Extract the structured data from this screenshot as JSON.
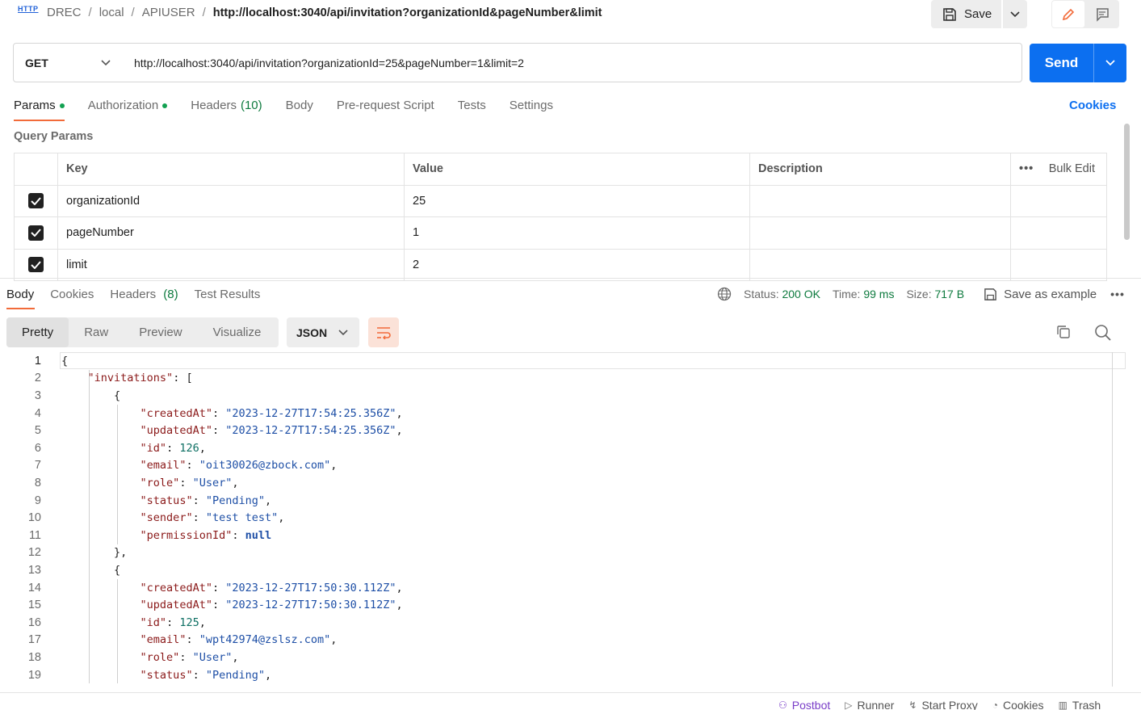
{
  "breadcrumb": {
    "method_icon": "HTTP",
    "items": [
      "DREC",
      "local",
      "APIUSER"
    ],
    "current": "http://localhost:3040/api/invitation?organizationId&pageNumber&limit"
  },
  "toolbar": {
    "save_label": "Save"
  },
  "request": {
    "method": "GET",
    "url": "http://localhost:3040/api/invitation?organizationId=25&pageNumber=1&limit=2",
    "send_label": "Send"
  },
  "request_tabs": [
    {
      "label": "Params",
      "dot": true
    },
    {
      "label": "Authorization",
      "dot": true
    },
    {
      "label": "Headers",
      "count": "(10)"
    },
    {
      "label": "Body"
    },
    {
      "label": "Pre-request Script"
    },
    {
      "label": "Tests"
    },
    {
      "label": "Settings"
    }
  ],
  "cookies_link": "Cookies",
  "query_params": {
    "title": "Query Params",
    "headers": {
      "key": "Key",
      "value": "Value",
      "description": "Description",
      "bulk_edit": "Bulk Edit"
    },
    "rows": [
      {
        "key": "organizationId",
        "value": "25",
        "checked": true
      },
      {
        "key": "pageNumber",
        "value": "1",
        "checked": true
      },
      {
        "key": "limit",
        "value": "2",
        "checked": true
      }
    ]
  },
  "response_tabs": [
    {
      "label": "Body"
    },
    {
      "label": "Cookies"
    },
    {
      "label": "Headers",
      "count": "(8)"
    },
    {
      "label": "Test Results"
    }
  ],
  "response_meta": {
    "status_label": "Status:",
    "status_value": "200 OK",
    "time_label": "Time:",
    "time_value": "99 ms",
    "size_label": "Size:",
    "size_value": "717 B",
    "save_example": "Save as example"
  },
  "view_tabs": [
    "Pretty",
    "Raw",
    "Preview",
    "Visualize"
  ],
  "format": "JSON",
  "code_lines": [
    "{",
    "    \"invitations\": [",
    "        {",
    "            \"createdAt\": \"2023-12-27T17:54:25.356Z\",",
    "            \"updatedAt\": \"2023-12-27T17:54:25.356Z\",",
    "            \"id\": 126,",
    "            \"email\": \"oit30026@zbock.com\",",
    "            \"role\": \"User\",",
    "            \"status\": \"Pending\",",
    "            \"sender\": \"test test\",",
    "            \"permissionId\": null",
    "        },",
    "        {",
    "            \"createdAt\": \"2023-12-27T17:50:30.112Z\",",
    "            \"updatedAt\": \"2023-12-27T17:50:30.112Z\",",
    "            \"id\": 125,",
    "            \"email\": \"wpt42974@zslsz.com\",",
    "            \"role\": \"User\",",
    "            \"status\": \"Pending\","
  ],
  "statusbar": [
    "Postbot",
    "Runner",
    "Start Proxy",
    "Cookies",
    "Trash"
  ],
  "colors": {
    "accent": "#0c6ff0",
    "tab_underline": "#f26b3a",
    "status_ok": "#0d7a3e"
  }
}
